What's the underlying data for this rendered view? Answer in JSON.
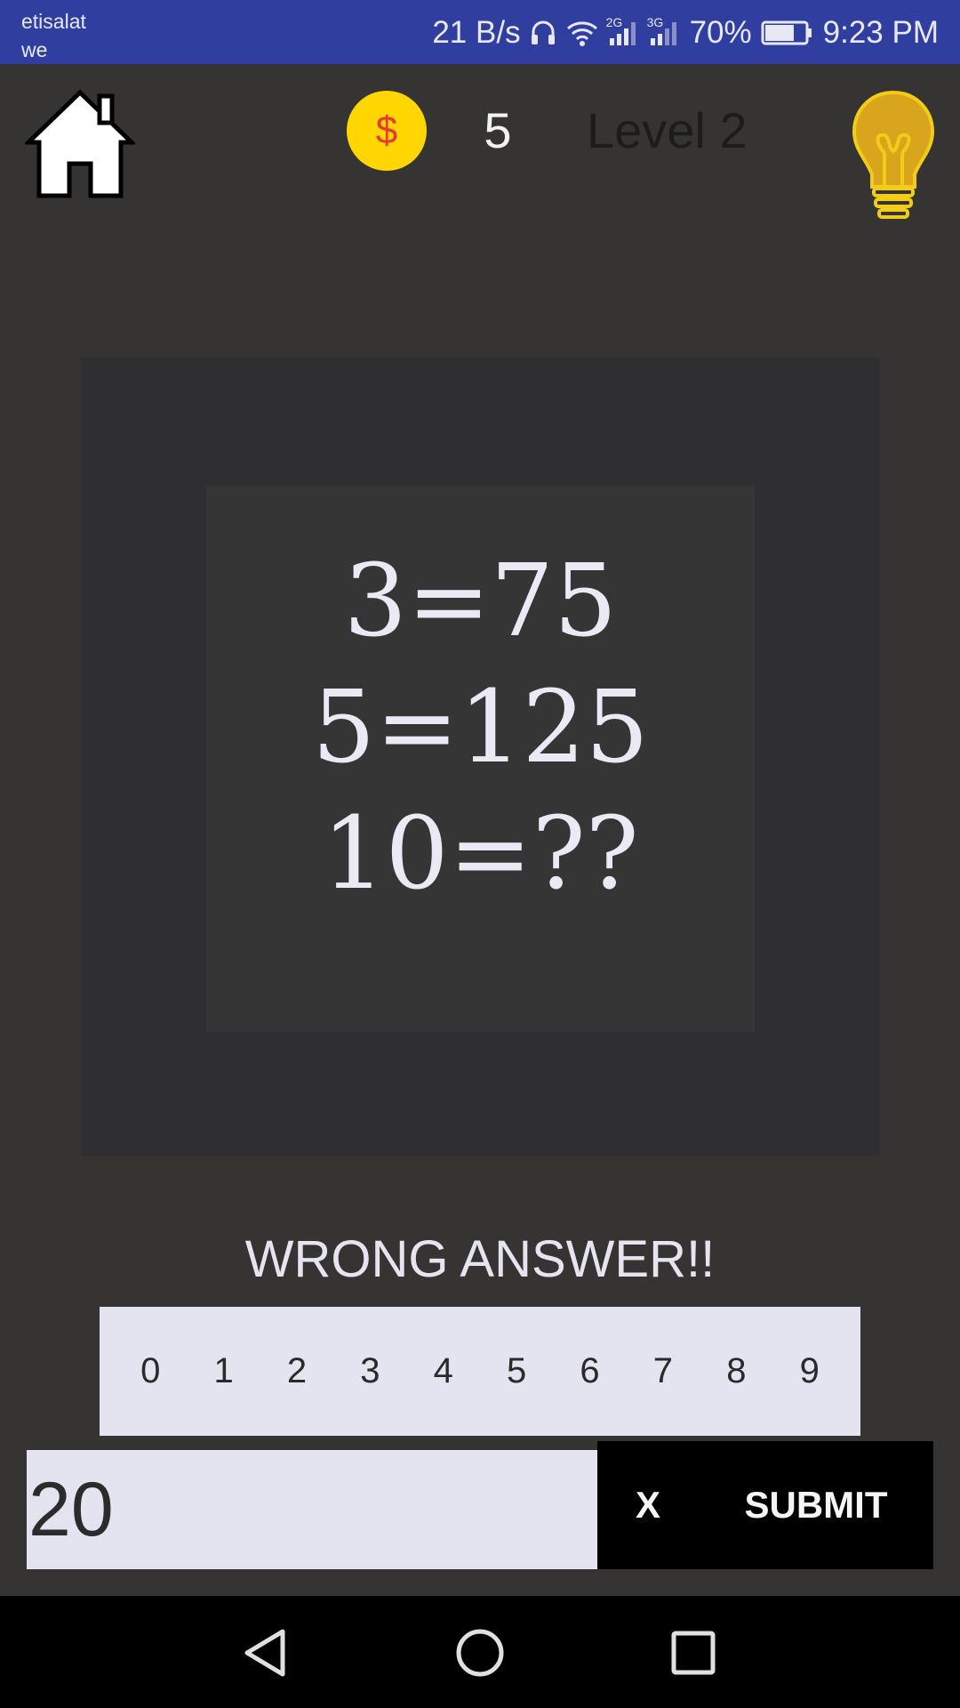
{
  "status_bar": {
    "carrier_line1": "etisalat",
    "carrier_line2": "we",
    "net_speed": "21 B/s",
    "network_1": "2G",
    "network_2": "3G",
    "battery": "70%",
    "time": "9:23 PM",
    "icons": [
      "headset-icon",
      "wifi-icon",
      "signal-icon",
      "signal-icon",
      "battery-icon"
    ]
  },
  "header": {
    "coin_symbol": "$",
    "coins": "5",
    "level": "Level 2"
  },
  "puzzle": {
    "lines": [
      "3=75",
      "5=125",
      "10=??"
    ]
  },
  "feedback": "WRONG ANSWER!!",
  "keypad": {
    "keys": [
      "0",
      "1",
      "2",
      "3",
      "4",
      "5",
      "6",
      "7",
      "8",
      "9"
    ]
  },
  "answer": {
    "value": "20",
    "clear_label": "X",
    "submit_label": "SUBMIT"
  },
  "colors": {
    "status_bar": "#303F9F",
    "background": "#353433",
    "coin": "#FFD600",
    "bulb": "#E2AA1E",
    "keypad": "#e4e3f0"
  }
}
